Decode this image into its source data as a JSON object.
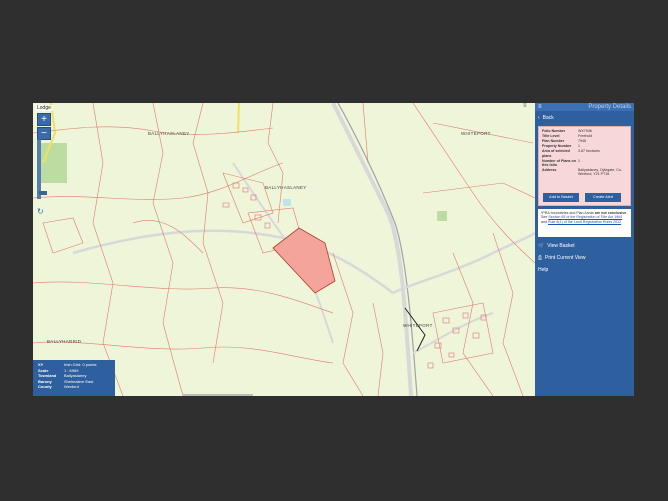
{
  "map": {
    "layer_name": "Lodge",
    "zoom_in": "+",
    "zoom_out": "−",
    "refresh_icon": "↻",
    "collapse_icon": "≡",
    "labels": {
      "ballyhaslaney_1": "BALLYHASLANEY",
      "ballyhaslaney_2": "BALLYHASLANEY",
      "whiteport_1": "WHITEPORT",
      "whiteport_2": "WHITEPORT",
      "knockbrack": "KNOCKBRACK",
      "ballyharrid": "BALLYHARRID"
    },
    "colors": {
      "background": "#eef5d9",
      "boundary": "#e07a6a",
      "selected_fill": "#f4a49a",
      "road": "#d8d8d8",
      "rail": "#9aa6a6",
      "highlight_road": "#f2e15a",
      "water": "#bde6ea",
      "forest": "#9ccc7c",
      "black_line": "#222222"
    }
  },
  "legend": {
    "rows": [
      {
        "key": "XY",
        "value": "Irish Grid: 0 points"
      },
      {
        "key": "Scale",
        "value": "1 : 6969"
      },
      {
        "key": "Townland",
        "value": "Ballyaslaney"
      },
      {
        "key": "Barony",
        "value": "Shelmalere East"
      },
      {
        "key": "County",
        "value": "Wexford"
      }
    ]
  },
  "panel": {
    "menu_icon": "≡",
    "title": "Property Details",
    "back_label": "Back",
    "back_icon": "‹",
    "details": [
      {
        "key": "Folio Number",
        "value": "WX7946"
      },
      {
        "key": "Title Level",
        "value": "Freehold"
      },
      {
        "key": "Plan Number",
        "value": "7946"
      },
      {
        "key": "Property Number",
        "value": "1"
      },
      {
        "key": "Area of selected plans",
        "value": "3.87 hectares"
      },
      {
        "key": "Number of Plans on this folio",
        "value": "1"
      },
      {
        "key": "Address",
        "value": "Ballyaslaney, Oylegate, Co. Wexford, Y21 PT16"
      }
    ],
    "add_to_basket": "Add to Basket",
    "create_alert": "Create Alert",
    "note_prefix": "*PRA boundaries and Plan Areas",
    "note_bold": "are not conclusive",
    "note_mid": ". See",
    "note_link1": "Section 85 of the Registration of Title Act 1964",
    "note_and": "and",
    "note_link2": "Rule 8(1) of the Land Registration Rules 2012",
    "view_basket": "View Basket",
    "view_basket_icon": "🛒",
    "print_view": "Print Current View",
    "print_icon": "⎙",
    "help": "Help"
  }
}
